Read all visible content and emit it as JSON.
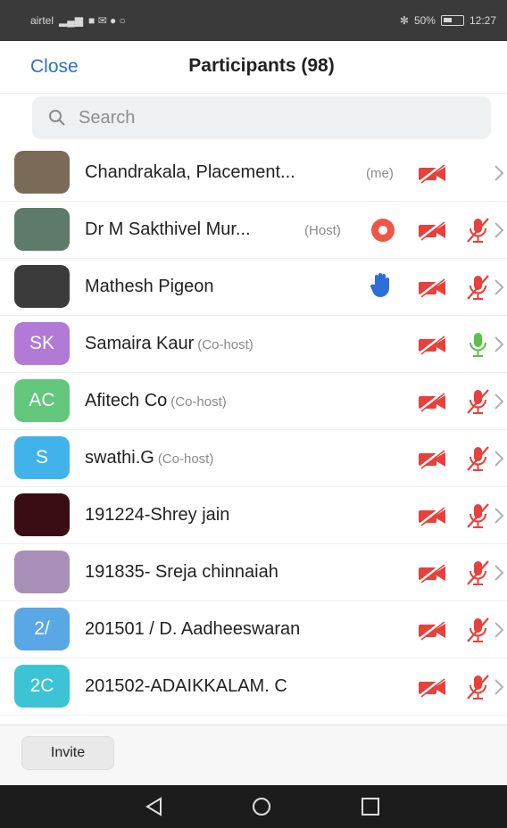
{
  "status_bar": {
    "carrier": "airtel",
    "battery_text": "50%",
    "battery_level": 0.5,
    "time": "12:27"
  },
  "header": {
    "close_label": "Close",
    "title": "Participants (98)"
  },
  "search": {
    "placeholder": "Search"
  },
  "participants": [
    {
      "name": "Chandrakala, Placement...",
      "role": "",
      "tag": "(me)",
      "avatar_initials": "",
      "avatar_color": "#7a6a58",
      "video_off": true,
      "mic": "none",
      "extra": ""
    },
    {
      "name": "Dr M Sakthivel Mur...",
      "role": "",
      "tag": "(Host)",
      "avatar_initials": "",
      "avatar_color": "#5d7a6a",
      "video_off": true,
      "mic": "muted",
      "extra": "share"
    },
    {
      "name": "Mathesh Pigeon",
      "role": "",
      "tag": "",
      "avatar_initials": "",
      "avatar_color": "#3b3b3b",
      "video_off": true,
      "mic": "muted",
      "extra": "hand"
    },
    {
      "name": "Samaira Kaur",
      "role": "(Co-host)",
      "tag": "",
      "avatar_initials": "SK",
      "avatar_color": "#b07ad6",
      "video_off": true,
      "mic": "on",
      "extra": ""
    },
    {
      "name": "Afitech Co",
      "role": "(Co-host)",
      "tag": "",
      "avatar_initials": "AC",
      "avatar_color": "#63c77b",
      "video_off": true,
      "mic": "muted",
      "extra": ""
    },
    {
      "name": "swathi.G",
      "role": "(Co-host)",
      "tag": "",
      "avatar_initials": "S",
      "avatar_color": "#42b3ea",
      "video_off": true,
      "mic": "muted",
      "extra": ""
    },
    {
      "name": "191224-Shrey jain",
      "role": "",
      "tag": "",
      "avatar_initials": "",
      "avatar_color": "#3a0d14",
      "video_off": true,
      "mic": "muted",
      "extra": ""
    },
    {
      "name": "191835- Sreja chinnaiah",
      "role": "",
      "tag": "",
      "avatar_initials": "",
      "avatar_color": "#a78fb8",
      "video_off": true,
      "mic": "muted",
      "extra": ""
    },
    {
      "name": "201501 / D.  Aadheeswaran",
      "role": "",
      "tag": "",
      "avatar_initials": "2/",
      "avatar_color": "#5aa7e6",
      "video_off": true,
      "mic": "muted",
      "extra": ""
    },
    {
      "name": "201502-ADAIKKALAM. C",
      "role": "",
      "tag": "",
      "avatar_initials": "2C",
      "avatar_color": "#3cc3d6",
      "video_off": true,
      "mic": "muted",
      "extra": ""
    }
  ],
  "bottom": {
    "invite_label": "Invite"
  },
  "colors": {
    "accent": "#2d6fd6",
    "video_off": "#e8403a",
    "mic_muted": "#e8403a",
    "mic_on": "#5fbf4d",
    "hand": "#2d6fd6",
    "share": "#ee5744"
  },
  "icons": {
    "search": "search-icon",
    "video_off": "video-off-icon",
    "mic_muted": "mic-muted-icon",
    "mic_on": "mic-on-icon",
    "hand": "raised-hand-icon",
    "share": "screen-share-icon",
    "chevron": "chevron-right-icon"
  }
}
